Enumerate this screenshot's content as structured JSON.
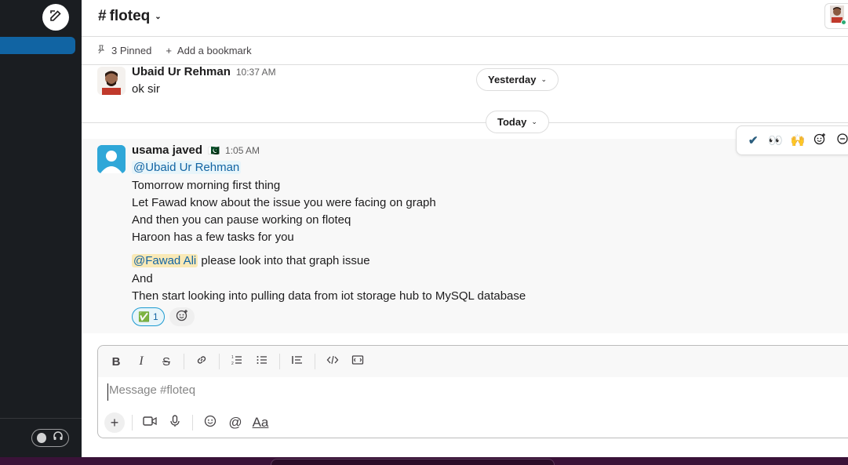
{
  "channel": {
    "name": "floteq",
    "hash": "#"
  },
  "bookmarks": {
    "pinned_label": "3 Pinned",
    "add_label": "Add a bookmark"
  },
  "dates": {
    "yesterday": "Yesterday",
    "today": "Today"
  },
  "messages": [
    {
      "author": "Ubaid Ur Rehman",
      "time": "10:37 AM",
      "lines": [
        "ok sir"
      ]
    },
    {
      "author": "usama javed",
      "status_flag": "🇵🇰",
      "time": "1:05 AM",
      "mention1": "@Ubaid Ur Rehman",
      "lines": [
        "Tomorrow morning first thing",
        "Let Fawad know about the issue you were facing on graph",
        "And then you can pause working on floteq",
        "Haroon has a few tasks for you"
      ],
      "mention2": "@Fawad Ali",
      "mention2_text": " please look into that graph issue",
      "lines2": [
        "And",
        "Then start looking into pulling data from iot storage hub to MySQL database"
      ],
      "reaction": {
        "emoji": "✅",
        "count": "1"
      }
    }
  ],
  "hover_actions": [
    "✔️",
    "👀",
    "🙌"
  ],
  "composer": {
    "placeholder": "Message #floteq",
    "format_label": "Aa"
  },
  "colors": {
    "sidebar": "#1a1d21",
    "accent": "#1164a3",
    "mention_bg": "#e8f5fa",
    "highlight_mention_bg": "#f9e9b6"
  }
}
